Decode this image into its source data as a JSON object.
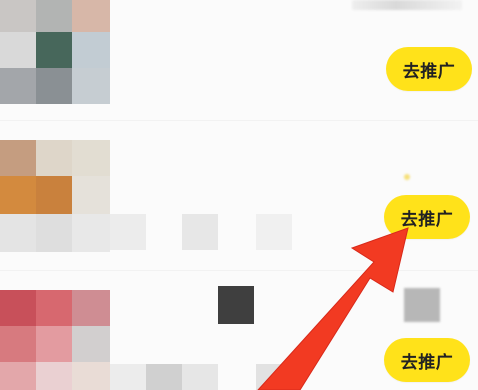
{
  "promote_buttons": [
    {
      "label": "去推广"
    },
    {
      "label": "去推广"
    },
    {
      "label": "去推广"
    }
  ],
  "colors": {
    "button": "#ffe21a",
    "arrow": "#f23a22",
    "background": "#fbfbfb"
  },
  "icons": {
    "arrow": "red-arrow-pointer"
  }
}
